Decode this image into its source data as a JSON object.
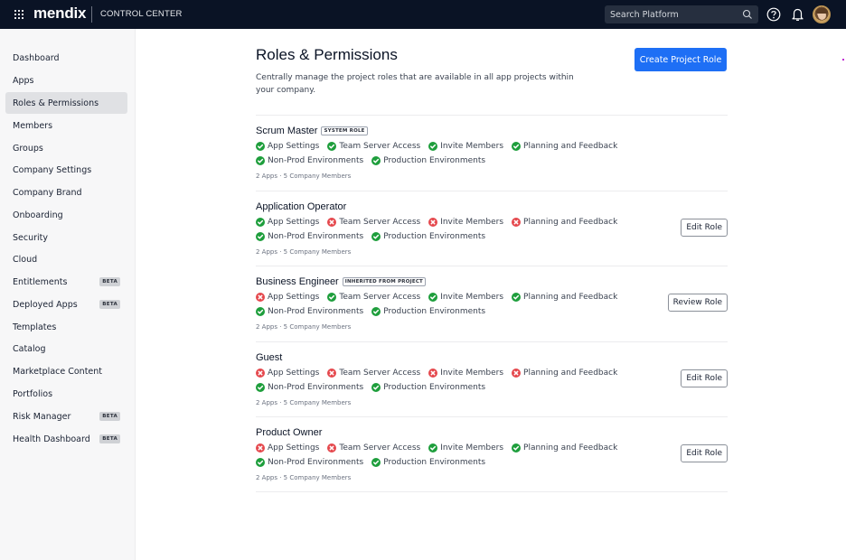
{
  "topbar": {
    "brand": "mendix",
    "product": "CONTROL CENTER",
    "search_placeholder": "Search Platform",
    "icons": [
      "apps-grid-icon",
      "search-icon",
      "help-icon",
      "bell-icon",
      "avatar"
    ]
  },
  "sidebar": {
    "items": [
      {
        "label": "Dashboard",
        "active": false,
        "badge": null
      },
      {
        "label": "Apps",
        "active": false,
        "badge": null
      },
      {
        "label": "Roles & Permissions",
        "active": true,
        "badge": null
      },
      {
        "label": "Members",
        "active": false,
        "badge": null
      },
      {
        "label": "Groups",
        "active": false,
        "badge": null
      },
      {
        "label": "Company Settings",
        "active": false,
        "badge": null
      },
      {
        "label": "Company Brand",
        "active": false,
        "badge": null
      },
      {
        "label": "Onboarding",
        "active": false,
        "badge": null
      },
      {
        "label": "Security",
        "active": false,
        "badge": null
      },
      {
        "label": "Cloud",
        "active": false,
        "badge": null
      },
      {
        "label": "Entitlements",
        "active": false,
        "badge": "BETA"
      },
      {
        "label": "Deployed Apps",
        "active": false,
        "badge": "BETA"
      },
      {
        "label": "Templates",
        "active": false,
        "badge": null
      },
      {
        "label": "Catalog",
        "active": false,
        "badge": null
      },
      {
        "label": "Marketplace Content",
        "active": false,
        "badge": null
      },
      {
        "label": "Portfolios",
        "active": false,
        "badge": null
      },
      {
        "label": "Risk Manager",
        "active": false,
        "badge": "BETA"
      },
      {
        "label": "Health Dashboard",
        "active": false,
        "badge": "BETA"
      }
    ]
  },
  "main": {
    "title": "Roles & Permissions",
    "description": "Centrally manage the project roles that are available in all app projects within your company.",
    "create_button": "Create Project Role",
    "colors": {
      "accent": "#1e6ff5",
      "granted": "#1e9e3c",
      "denied": "#e5484d"
    },
    "roles": [
      {
        "name": "Scrum Master",
        "tag": "SYSTEM ROLE",
        "permissions": [
          {
            "label": "App Settings",
            "granted": true
          },
          {
            "label": "Team Server Access",
            "granted": true
          },
          {
            "label": "Invite Members",
            "granted": true
          },
          {
            "label": "Planning and Feedback",
            "granted": true
          },
          {
            "label": "Non-Prod Environments",
            "granted": true
          },
          {
            "label": "Production Environments",
            "granted": true
          }
        ],
        "meta": "2 Apps · 5 Company Members",
        "action": null
      },
      {
        "name": "Application Operator",
        "tag": null,
        "permissions": [
          {
            "label": "App Settings",
            "granted": true
          },
          {
            "label": "Team Server Access",
            "granted": false
          },
          {
            "label": "Invite Members",
            "granted": false
          },
          {
            "label": "Planning and Feedback",
            "granted": false
          },
          {
            "label": "Non-Prod Environments",
            "granted": true
          },
          {
            "label": "Production Environments",
            "granted": true
          }
        ],
        "meta": "2 Apps · 5 Company Members",
        "action": "Edit Role"
      },
      {
        "name": "Business Engineer",
        "tag": "INHERITED FROM PROJECT",
        "permissions": [
          {
            "label": "App Settings",
            "granted": false
          },
          {
            "label": "Team Server Access",
            "granted": true
          },
          {
            "label": "Invite Members",
            "granted": true
          },
          {
            "label": "Planning and Feedback",
            "granted": true
          },
          {
            "label": "Non-Prod Environments",
            "granted": true
          },
          {
            "label": "Production Environments",
            "granted": true
          }
        ],
        "meta": "2 Apps · 5 Company Members",
        "action": "Review Role"
      },
      {
        "name": "Guest",
        "tag": null,
        "permissions": [
          {
            "label": "App Settings",
            "granted": false
          },
          {
            "label": "Team Server Access",
            "granted": false
          },
          {
            "label": "Invite Members",
            "granted": false
          },
          {
            "label": "Planning and Feedback",
            "granted": false
          },
          {
            "label": "Non-Prod Environments",
            "granted": true
          },
          {
            "label": "Production Environments",
            "granted": true
          }
        ],
        "meta": "2 Apps · 5 Company Members",
        "action": "Edit Role"
      },
      {
        "name": "Product Owner",
        "tag": null,
        "permissions": [
          {
            "label": "App Settings",
            "granted": false
          },
          {
            "label": "Team Server Access",
            "granted": false
          },
          {
            "label": "Invite Members",
            "granted": true
          },
          {
            "label": "Planning and Feedback",
            "granted": true
          },
          {
            "label": "Non-Prod Environments",
            "granted": true
          },
          {
            "label": "Production Environments",
            "granted": true
          }
        ],
        "meta": "2 Apps · 5 Company Members",
        "action": "Edit Role"
      }
    ]
  }
}
